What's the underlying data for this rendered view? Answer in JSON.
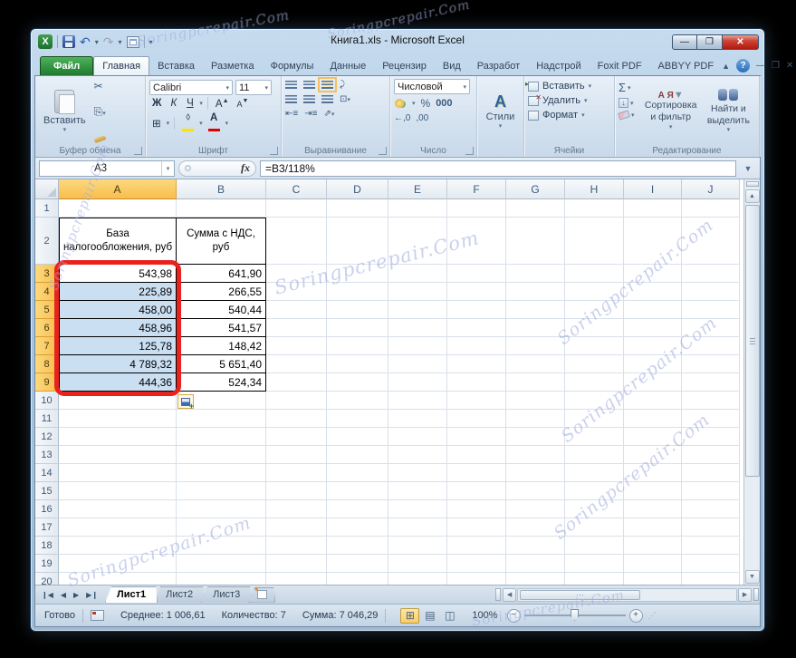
{
  "window": {
    "title": "Книга1.xls - Microsoft Excel"
  },
  "tabs": [
    {
      "label": "Файл",
      "type": "file"
    },
    {
      "label": "Главная",
      "active": true
    },
    {
      "label": "Вставка"
    },
    {
      "label": "Разметка"
    },
    {
      "label": "Формулы"
    },
    {
      "label": "Данные"
    },
    {
      "label": "Рецензир"
    },
    {
      "label": "Вид"
    },
    {
      "label": "Разработ"
    },
    {
      "label": "Надстрой"
    },
    {
      "label": "Foxit PDF"
    },
    {
      "label": "ABBYY PDF"
    }
  ],
  "ribbon": {
    "clipboard": {
      "label": "Буфер обмена",
      "paste": "Вставить"
    },
    "font": {
      "label": "Шрифт",
      "font_name": "Calibri",
      "font_size": "11",
      "bold": "Ж",
      "italic": "К",
      "underline": "Ч",
      "grow": "А",
      "shrink": "А"
    },
    "alignment": {
      "label": "Выравнивание"
    },
    "number": {
      "label": "Число",
      "format": "Числовой",
      "percent": "%",
      "thousands": "000",
      "inc_decimal": "←,0",
      "dec_decimal": ",00"
    },
    "styles": {
      "label": "Стили"
    },
    "cells": {
      "label": "Ячейки",
      "insert": "Вставить",
      "delete": "Удалить",
      "format": "Формат"
    },
    "editing": {
      "label": "Редактирование",
      "autosum": "Σ",
      "sort_filter": "Сортировка и фильтр",
      "find_select": "Найти и выделить",
      "sort_az": "А Я"
    }
  },
  "formula_bar": {
    "name_box": "A3",
    "fx": "fx",
    "formula": "=B3/118%"
  },
  "grid": {
    "columns": [
      "A",
      "B",
      "C",
      "D",
      "E",
      "F",
      "G",
      "H",
      "I",
      "J"
    ],
    "selected_column": "A",
    "row_count": 20,
    "selected_rows": [
      3,
      4,
      5,
      6,
      7,
      8,
      9
    ],
    "table": {
      "header_a": "База налогообложения, руб",
      "header_b": "Сумма с НДС, руб",
      "data": [
        [
          "543,98",
          "641,90"
        ],
        [
          "225,89",
          "266,55"
        ],
        [
          "458,00",
          "540,44"
        ],
        [
          "458,96",
          "541,57"
        ],
        [
          "125,78",
          "148,42"
        ],
        [
          "4 789,32",
          "5 651,40"
        ],
        [
          "444,36",
          "524,34"
        ]
      ]
    }
  },
  "sheet_tabs": {
    "tabs": [
      "Лист1",
      "Лист2",
      "Лист3"
    ],
    "active": "Лист1"
  },
  "status_bar": {
    "mode": "Готово",
    "average": "Среднее: 1 006,61",
    "count": "Количество: 7",
    "sum": "Сумма: 7 046,29",
    "zoom": "100%"
  },
  "watermark": {
    "text": "Soringpcrepair.Com"
  }
}
